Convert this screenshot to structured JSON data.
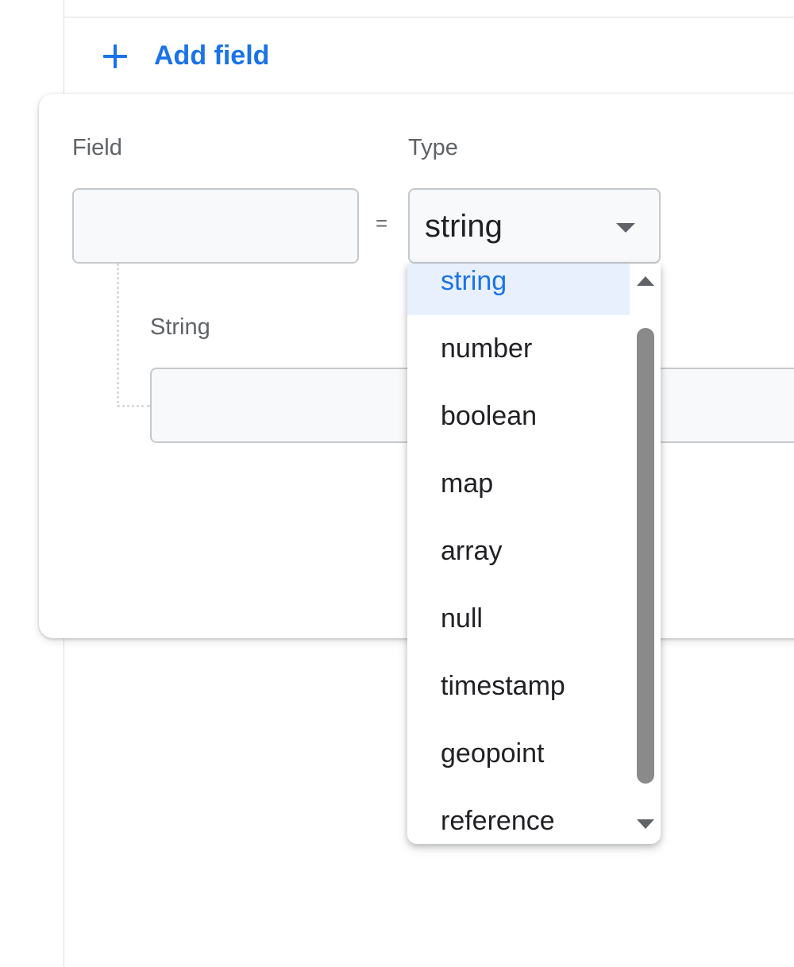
{
  "toolbar": {
    "add_field_label": "Add field"
  },
  "form": {
    "field_label": "Field",
    "type_label": "Type",
    "equals": "=",
    "type_value": "string",
    "string_label": "String"
  },
  "dropdown": {
    "options": [
      "string",
      "number",
      "boolean",
      "map",
      "array",
      "null",
      "timestamp",
      "geopoint",
      "reference"
    ],
    "selected": "string"
  },
  "colors": {
    "accent": "#1a73e8",
    "selected_bg": "#e8f0fe",
    "text": "#202124",
    "muted": "#5f6368",
    "border": "#c6c9cc",
    "scrollbar": "#8a8a8a"
  }
}
